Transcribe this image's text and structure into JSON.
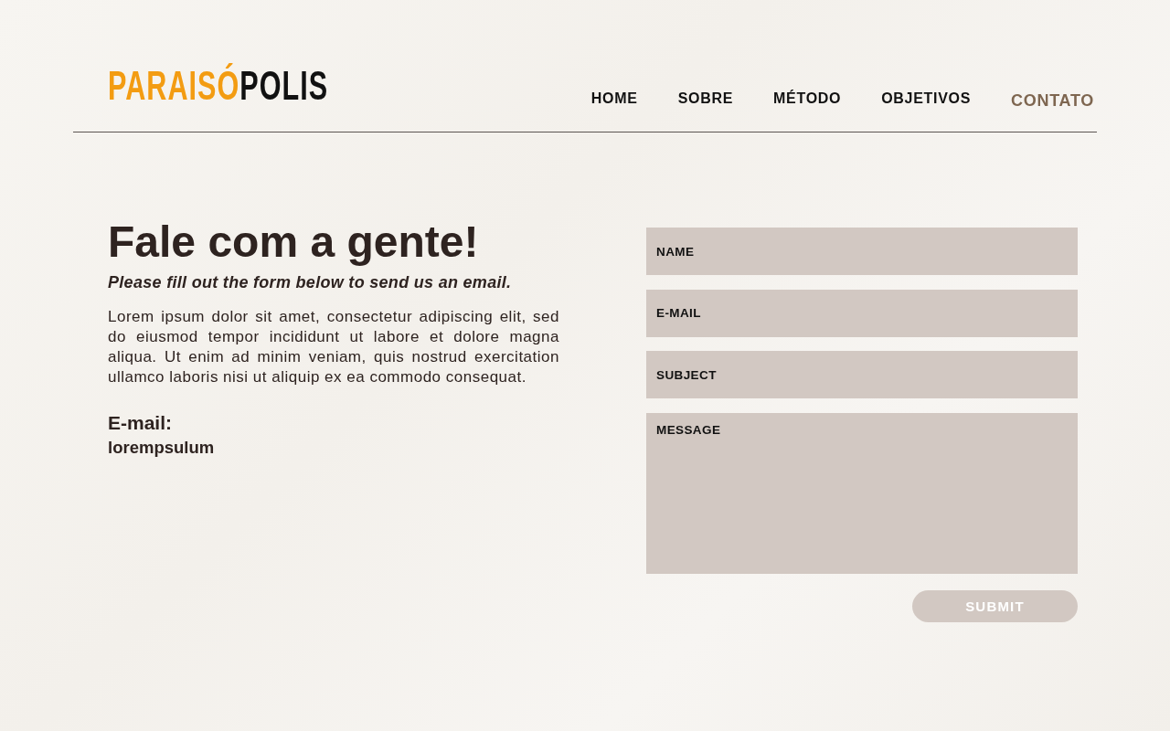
{
  "logo": {
    "accent": "PARAISÓ",
    "rest": "POLIS"
  },
  "nav": [
    {
      "label": "HOME",
      "selected": false
    },
    {
      "label": "SOBRE",
      "selected": false
    },
    {
      "label": "MÉTODO",
      "selected": false
    },
    {
      "label": "OBJETIVOS",
      "selected": false
    },
    {
      "label": "CONTATO",
      "selected": true
    }
  ],
  "contact": {
    "title": "Fale com a gente!",
    "subtitle": "Please fill out the form below to send us an email.",
    "body": "Lorem ipsum dolor sit amet, consectetur adipiscing elit, sed do eiusmod tempor incididunt ut labore et dolore magna aliqua. Ut enim ad minim veniam, quis nostrud exercitation ullamco laboris nisi ut aliquip ex ea commodo consequat.",
    "email_label": "E-mail:",
    "email_value": "lorempsulum"
  },
  "form": {
    "fields": [
      {
        "kind": "input",
        "placeholder": "NAME"
      },
      {
        "kind": "input",
        "placeholder": "E-MAIL"
      },
      {
        "kind": "input",
        "placeholder": "SUBJECT"
      },
      {
        "kind": "textarea",
        "placeholder": "MESSAGE"
      }
    ],
    "submit": "SUBMIT"
  }
}
